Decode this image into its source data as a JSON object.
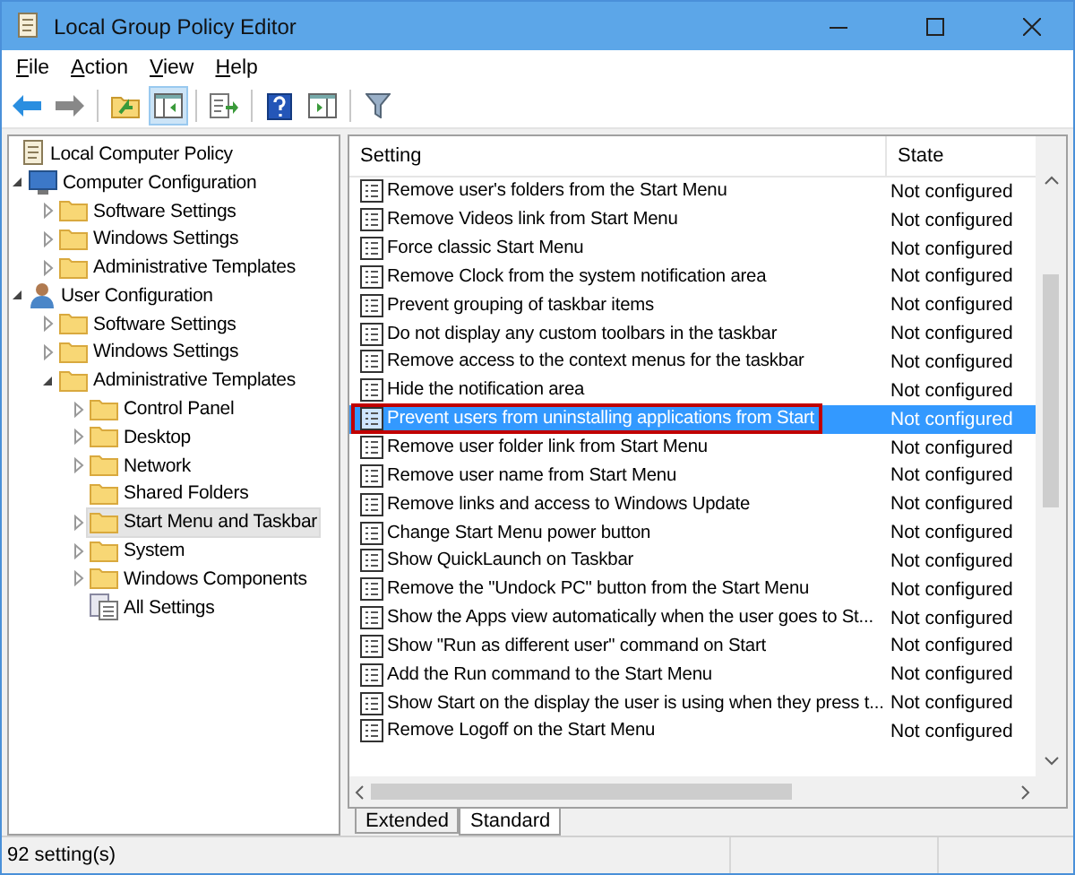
{
  "window": {
    "title": "Local Group Policy Editor"
  },
  "menu": [
    {
      "label": "File"
    },
    {
      "label": "Action"
    },
    {
      "label": "View"
    },
    {
      "label": "Help"
    }
  ],
  "toolbar": [
    {
      "kind": "back",
      "pressed": false
    },
    {
      "kind": "forward",
      "pressed": false
    },
    {
      "kind": "sep"
    },
    {
      "kind": "up",
      "pressed": false
    },
    {
      "kind": "tree",
      "pressed": true
    },
    {
      "kind": "sep"
    },
    {
      "kind": "export",
      "pressed": false
    },
    {
      "kind": "sep"
    },
    {
      "kind": "help",
      "pressed": false
    },
    {
      "kind": "pane",
      "pressed": false
    },
    {
      "kind": "sep"
    },
    {
      "kind": "filter",
      "pressed": false
    }
  ],
  "tree": [
    {
      "label": "Local Computer Policy",
      "kind": "policy",
      "selected": false,
      "children": [
        {
          "label": "Computer Configuration",
          "kind": "computer",
          "expanded": true,
          "selected": false,
          "children": [
            {
              "label": "Software Settings",
              "kind": "folder",
              "expanded": false,
              "selected": false
            },
            {
              "label": "Windows Settings",
              "kind": "folder",
              "expanded": false,
              "selected": false
            },
            {
              "label": "Administrative Templates",
              "kind": "folder",
              "expanded": false,
              "selected": false
            }
          ]
        },
        {
          "label": "User Configuration",
          "kind": "user",
          "expanded": true,
          "selected": false,
          "children": [
            {
              "label": "Software Settings",
              "kind": "folder",
              "expanded": false,
              "selected": false
            },
            {
              "label": "Windows Settings",
              "kind": "folder",
              "expanded": false,
              "selected": false
            },
            {
              "label": "Administrative Templates",
              "kind": "folder",
              "expanded": true,
              "selected": false,
              "children": [
                {
                  "label": "Control Panel",
                  "kind": "folder",
                  "expanded": false,
                  "selected": false
                },
                {
                  "label": "Desktop",
                  "kind": "folder",
                  "expanded": false,
                  "selected": false
                },
                {
                  "label": "Network",
                  "kind": "folder",
                  "expanded": false,
                  "selected": false
                },
                {
                  "label": "Shared Folders",
                  "kind": "folder",
                  "selected": false
                },
                {
                  "label": "Start Menu and Taskbar",
                  "kind": "folder",
                  "expanded": false,
                  "selected": true
                },
                {
                  "label": "System",
                  "kind": "folder",
                  "expanded": false,
                  "selected": false
                },
                {
                  "label": "Windows Components",
                  "kind": "folder",
                  "expanded": false,
                  "selected": false
                },
                {
                  "label": "All Settings",
                  "kind": "settings",
                  "selected": false
                }
              ]
            }
          ]
        }
      ]
    }
  ],
  "table": {
    "columns": [
      "Setting",
      "State"
    ],
    "rows": [
      {
        "setting": "Remove user's folders from the Start Menu",
        "state": "Not configured",
        "selected": false,
        "outlined": false
      },
      {
        "setting": "Remove Videos link from Start Menu",
        "state": "Not configured",
        "selected": false,
        "outlined": false
      },
      {
        "setting": "Force classic Start Menu",
        "state": "Not configured",
        "selected": false,
        "outlined": false
      },
      {
        "setting": "Remove Clock from the system notification area",
        "state": "Not configured",
        "selected": false,
        "outlined": false
      },
      {
        "setting": "Prevent grouping of taskbar items",
        "state": "Not configured",
        "selected": false,
        "outlined": false
      },
      {
        "setting": "Do not display any custom toolbars in the taskbar",
        "state": "Not configured",
        "selected": false,
        "outlined": false
      },
      {
        "setting": "Remove access to the context menus for the taskbar",
        "state": "Not configured",
        "selected": false,
        "outlined": false
      },
      {
        "setting": "Hide the notification area",
        "state": "Not configured",
        "selected": false,
        "outlined": false
      },
      {
        "setting": "Prevent users from uninstalling applications from Start",
        "state": "Not configured",
        "selected": true,
        "outlined": true
      },
      {
        "setting": "Remove user folder link from Start Menu",
        "state": "Not configured",
        "selected": false,
        "outlined": false
      },
      {
        "setting": "Remove user name from Start Menu",
        "state": "Not configured",
        "selected": false,
        "outlined": false
      },
      {
        "setting": "Remove links and access to Windows Update",
        "state": "Not configured",
        "selected": false,
        "outlined": false
      },
      {
        "setting": "Change Start Menu power button",
        "state": "Not configured",
        "selected": false,
        "outlined": false
      },
      {
        "setting": "Show QuickLaunch on Taskbar",
        "state": "Not configured",
        "selected": false,
        "outlined": false
      },
      {
        "setting": "Remove the \"Undock PC\" button from the Start Menu",
        "state": "Not configured",
        "selected": false,
        "outlined": false
      },
      {
        "setting": "Show the Apps view automatically when the user goes to St...",
        "state": "Not configured",
        "selected": false,
        "outlined": false
      },
      {
        "setting": "Show \"Run as different user\" command on Start",
        "state": "Not configured",
        "selected": false,
        "outlined": false
      },
      {
        "setting": "Add the Run command to the Start Menu",
        "state": "Not configured",
        "selected": false,
        "outlined": false
      },
      {
        "setting": "Show Start on the display the user is using when they press t...",
        "state": "Not configured",
        "selected": false,
        "outlined": false
      },
      {
        "setting": "Remove Logoff on the Start Menu",
        "state": "Not configured",
        "selected": false,
        "outlined": false
      }
    ]
  },
  "view_tabs": [
    {
      "label": "Extended",
      "selected": false
    },
    {
      "label": "Standard",
      "selected": true
    }
  ],
  "status_bar": {
    "text": "92 setting(s)"
  }
}
